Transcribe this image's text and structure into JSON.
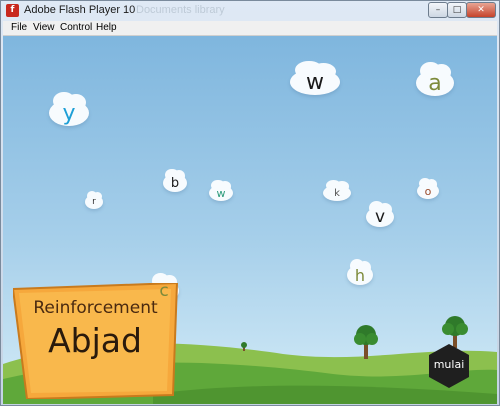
{
  "window": {
    "title": "Adobe Flash Player 10",
    "background_title": "Documents library",
    "buttons": {
      "minimize": "–",
      "maximize": "□",
      "close": "✕"
    }
  },
  "menu": [
    "File",
    "View",
    "Control",
    "Help"
  ],
  "game": {
    "letters": [
      "w",
      "a",
      "y",
      "b",
      "w",
      "k",
      "o",
      "r",
      "v",
      "h",
      "c"
    ],
    "title_line1": "Reinforcement",
    "title_line2": "Abjad",
    "logo": "mulai"
  },
  "colors": {
    "sky_top": "#7fb6de",
    "sky_bottom": "#d3ebf7",
    "grass": "#5fa83a",
    "banner": "#f6a83c",
    "letter_blue": "#1e9fd6",
    "letter_olive": "#7c8a3a"
  }
}
